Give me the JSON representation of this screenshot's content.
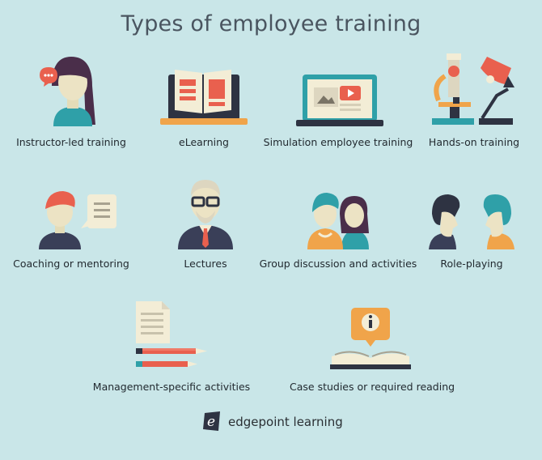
{
  "title": "Types of employee training",
  "items": [
    {
      "label": "Instructor-led training",
      "icon": "instructor-icon"
    },
    {
      "label": "eLearning",
      "icon": "laptop-book-icon"
    },
    {
      "label": "Simulation employee training",
      "icon": "laptop-video-icon"
    },
    {
      "label": "Hands-on training",
      "icon": "microscope-lamp-icon"
    },
    {
      "label": "Coaching or mentoring",
      "icon": "coach-speech-icon"
    },
    {
      "label": "Lectures",
      "icon": "lecturer-icon"
    },
    {
      "label": "Group discussion and activities",
      "icon": "group-icon"
    },
    {
      "label": "Role-playing",
      "icon": "two-people-icon"
    },
    {
      "label": "Management-specific activities",
      "icon": "document-pencil-icon"
    },
    {
      "label": "Case studies or required reading",
      "icon": "open-book-info-icon"
    }
  ],
  "brand": {
    "name": "edgepoint learning",
    "logo_letter": "e"
  },
  "colors": {
    "background": "#c9e6e8",
    "orange": "#f0a44a",
    "red": "#e9604e",
    "teal": "#36a6b5",
    "navy": "#3a3f58"
  }
}
